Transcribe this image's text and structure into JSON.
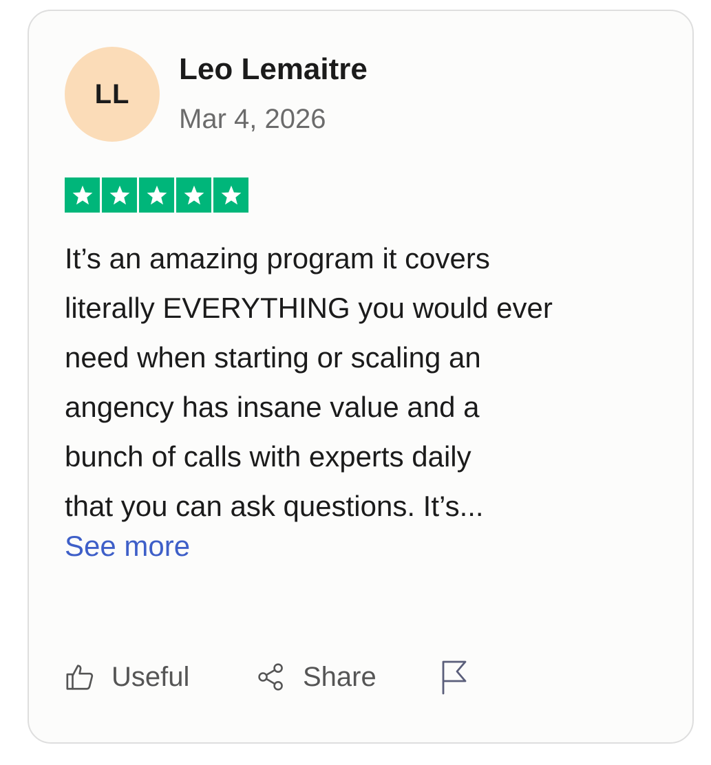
{
  "review": {
    "author": {
      "initials": "LL",
      "name": "Leo Lemaitre",
      "avatar_color": "#fbdcb8"
    },
    "date": "Mar 4, 2026",
    "rating": 5,
    "rating_max": 5,
    "star_color": "#00b67a",
    "body_lines": [
      "It’s an amazing program it covers",
      "literally EVERYTHING you would ever",
      "need when starting or scaling an",
      "angency has insane value and a",
      "bunch of calls with experts daily",
      "that you can ask questions. It’s..."
    ],
    "see_more_label": "See more",
    "link_color": "#3e5fc8"
  },
  "actions": {
    "useful_label": "Useful",
    "useful_icon": "thumbs-up-icon",
    "share_label": "Share",
    "share_icon": "share-icon",
    "report_icon": "flag-icon"
  }
}
